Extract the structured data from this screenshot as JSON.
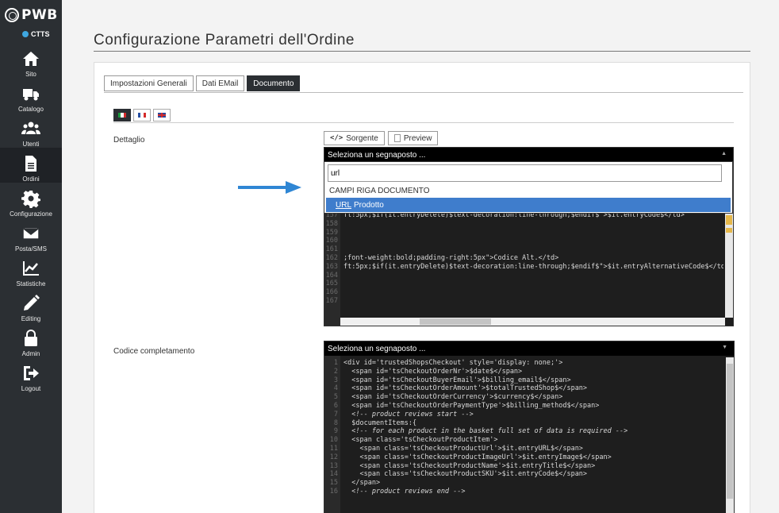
{
  "sidebar": {
    "logo": "PWB",
    "context": "CTTS",
    "items": [
      {
        "label": "Sito",
        "icon": "home-icon"
      },
      {
        "label": "Catalogo",
        "icon": "truck-icon"
      },
      {
        "label": "Utenti",
        "icon": "users-icon"
      },
      {
        "label": "Ordini",
        "icon": "document-icon"
      },
      {
        "label": "Configurazione",
        "icon": "gear-icon"
      },
      {
        "label": "Posta/SMS",
        "icon": "envelope-icon"
      },
      {
        "label": "Statistiche",
        "icon": "chart-icon"
      },
      {
        "label": "Editing",
        "icon": "pencil-icon"
      },
      {
        "label": "Admin",
        "icon": "lock-icon"
      },
      {
        "label": "Logout",
        "icon": "logout-icon"
      }
    ],
    "active_item": "Ordini"
  },
  "page": {
    "title": "Configurazione Parametri dell'Ordine"
  },
  "tabs": [
    "Impostazioni Generali",
    "Dati EMail",
    "Documento"
  ],
  "active_tab": "Documento",
  "languages": [
    "it",
    "fr",
    "en"
  ],
  "active_language": "it",
  "fields": {
    "dettaglio_label": "Dettaglio",
    "codice_label": "Codice completamento"
  },
  "editor_buttons": {
    "source": "Sorgente",
    "preview": "Preview"
  },
  "editor1": {
    "placeholder_bar": "Seleziona un segnaposto ...",
    "lines": [
      {
        "n": "157",
        "text": "ft:5px;$if(it.entryDelete)$text-decoration:line-through;$endif$\">$it.entryCode$</td>"
      },
      {
        "n": "158",
        "text": ""
      },
      {
        "n": "159",
        "text": ""
      },
      {
        "n": "160",
        "text": ""
      },
      {
        "n": "161",
        "text": ""
      },
      {
        "n": "162",
        "text": ";font-weight:bold;padding-right:5px\">Codice Alt.</td>"
      },
      {
        "n": "163",
        "text": "ft:5px;$if(it.entryDelete)$text-decoration:line-through;$endif$\">$it.entryAlternativeCode$</td>"
      },
      {
        "n": "164",
        "text": ""
      },
      {
        "n": "165",
        "text": ""
      },
      {
        "n": "166",
        "text": ""
      },
      {
        "n": "167",
        "text": ""
      }
    ]
  },
  "dropdown": {
    "search_value": "url",
    "group": "CAMPI RIGA DOCUMENTO",
    "option_match": "URL",
    "option_rest": "Prodotto"
  },
  "editor2": {
    "placeholder_bar": "Seleziona un segnaposto ...",
    "lines": [
      {
        "n": "1",
        "text": "<div id='trustedShopsCheckout' style='display: none;'>"
      },
      {
        "n": "2",
        "text": "  <span id='tsCheckoutOrderNr'>$date$</span>"
      },
      {
        "n": "3",
        "text": "  <span id='tsCheckoutBuyerEmail'>$billing_email$</span>"
      },
      {
        "n": "4",
        "text": "  <span id='tsCheckoutOrderAmount'>$totalTrustedShop$</span>"
      },
      {
        "n": "5",
        "text": "  <span id='tsCheckoutOrderCurrency'>$currency$</span>"
      },
      {
        "n": "6",
        "text": "  <span id='tsCheckoutOrderPaymentType'>$billing_method$</span>"
      },
      {
        "n": "7",
        "text": "  <!-- product reviews start -->"
      },
      {
        "n": "8",
        "text": "  $documentItems:{"
      },
      {
        "n": "9",
        "text": "  <!-- for each product in the basket full set of data is required -->"
      },
      {
        "n": "10",
        "text": "  <span class='tsCheckoutProductItem'>"
      },
      {
        "n": "11",
        "text": "    <span class='tsCheckoutProductUrl'>$it.entryURL$</span>"
      },
      {
        "n": "12",
        "text": "    <span class='tsCheckoutProductImageUrl'>$it.entryImage$</span>"
      },
      {
        "n": "13",
        "text": "    <span class='tsCheckoutProductName'>$it.entryTitle$</span>"
      },
      {
        "n": "14",
        "text": "    <span class='tsCheckoutProductSKU'>$it.entryCode$</span>"
      },
      {
        "n": "15",
        "text": "  </span>"
      },
      {
        "n": "16",
        "text": "  <!-- product reviews end -->"
      }
    ]
  },
  "colors": {
    "sidebar_bg": "#2b2f33",
    "accent_blue": "#3f7dcc",
    "arrow_blue": "#2f86d4"
  }
}
